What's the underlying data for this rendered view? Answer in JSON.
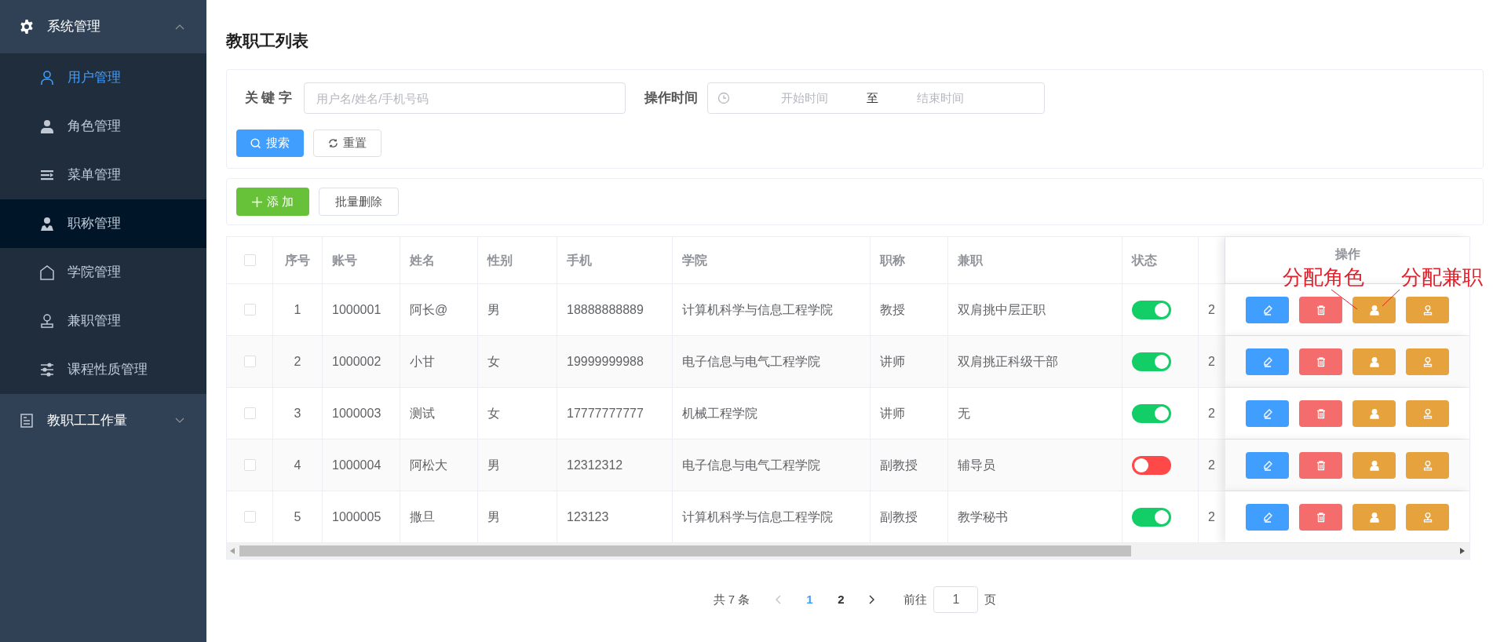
{
  "sidebar": {
    "groups": [
      {
        "label": "系统管理",
        "expanded": true,
        "items": [
          {
            "label": "用户管理",
            "selected": true,
            "hovered": false
          },
          {
            "label": "角色管理",
            "selected": false,
            "hovered": false
          },
          {
            "label": "菜单管理",
            "selected": false,
            "hovered": false
          },
          {
            "label": "职称管理",
            "selected": false,
            "hovered": true
          },
          {
            "label": "学院管理",
            "selected": false,
            "hovered": false
          },
          {
            "label": "兼职管理",
            "selected": false,
            "hovered": false
          },
          {
            "label": "课程性质管理",
            "selected": false,
            "hovered": false
          }
        ]
      },
      {
        "label": "教职工工作量",
        "expanded": false
      }
    ]
  },
  "page_title": "教职工列表",
  "filters": {
    "keyword_label": "关 键 字",
    "keyword_placeholder": "用户名/姓名/手机号码",
    "time_label": "操作时间",
    "start_placeholder": "开始时间",
    "range_separator": "至",
    "end_placeholder": "结束时间",
    "search_button": "搜索",
    "reset_button": "重置"
  },
  "toolbar": {
    "add_button": "添 加",
    "batch_delete_button": "批量删除"
  },
  "table": {
    "all_checked": false,
    "columns": [
      "序号",
      "账号",
      "姓名",
      "性别",
      "手机",
      "学院",
      "职称",
      "兼职",
      "状态",
      "",
      "操作"
    ],
    "rows": [
      {
        "checked": false,
        "cells": [
          "1",
          "1000001",
          "阿长@",
          "男",
          "18888888889",
          "计算机科学与信息工程学院",
          "教授",
          "双肩挑中层正职"
        ],
        "status_on": true,
        "column_11": "2"
      },
      {
        "checked": false,
        "cells": [
          "2",
          "1000002",
          "小甘",
          "女",
          "19999999988",
          "电子信息与电气工程学院",
          "讲师",
          "双肩挑正科级干部"
        ],
        "status_on": true,
        "column_11": "2"
      },
      {
        "checked": false,
        "cells": [
          "3",
          "1000003",
          "测试",
          "女",
          "17777777777",
          "机械工程学院",
          "讲师",
          "无"
        ],
        "status_on": true,
        "column_11": "2"
      },
      {
        "checked": false,
        "cells": [
          "4",
          "1000004",
          "阿松大",
          "男",
          "12312312",
          "电子信息与电气工程学院",
          "副教授",
          "辅导员"
        ],
        "status_on": false,
        "column_11": "2"
      },
      {
        "checked": false,
        "cells": [
          "5",
          "1000005",
          "撒旦",
          "男",
          "123123",
          "计算机科学与信息工程学院",
          "副教授",
          "教学秘书"
        ],
        "status_on": true,
        "column_11": "2"
      }
    ],
    "row_actions": [
      {
        "kind": "edit"
      },
      {
        "kind": "delete"
      },
      {
        "kind": "assign-role"
      },
      {
        "kind": "assign-parttime"
      }
    ]
  },
  "annotations": [
    {
      "text": "分配角色"
    },
    {
      "text": "分配兼职"
    }
  ],
  "pagination": {
    "total": "共 7 条",
    "pages": [
      {
        "label": "1",
        "selected": true
      },
      {
        "label": "2",
        "selected": false
      }
    ],
    "prev_disabled": true,
    "goto_label": "前往",
    "goto_value": "1",
    "page_suffix": "页"
  }
}
